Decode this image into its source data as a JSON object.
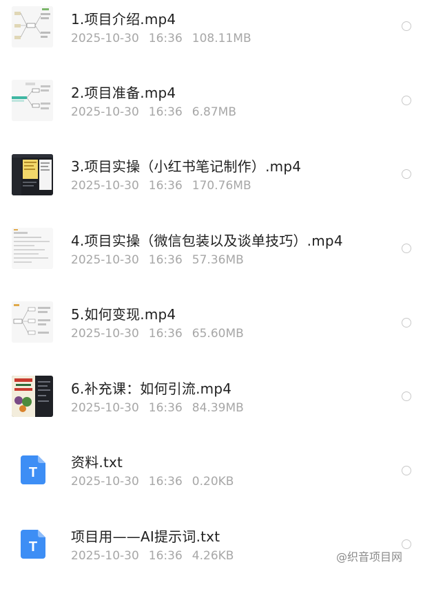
{
  "files": [
    {
      "name": "1.项目介绍.mp4",
      "date": "2025-10-30",
      "time": "16:36",
      "size": "108.11MB",
      "thumbnail": "mindmap-light"
    },
    {
      "name": "2.项目准备.mp4",
      "date": "2025-10-30",
      "time": "16:36",
      "size": "6.87MB",
      "thumbnail": "mindmap-teal"
    },
    {
      "name": "3.项目实操（小红书笔记制作）.mp4",
      "date": "2025-10-30",
      "time": "16:36",
      "size": "170.76MB",
      "thumbnail": "dark-editor"
    },
    {
      "name": "4.项目实操（微信包装以及谈单技巧）.mp4",
      "date": "2025-10-30",
      "time": "16:36",
      "size": "57.36MB",
      "thumbnail": "document-light"
    },
    {
      "name": "5.如何变现.mp4",
      "date": "2025-10-30",
      "time": "16:36",
      "size": "65.60MB",
      "thumbnail": "mindmap-light"
    },
    {
      "name": "6.补充课：如何引流.mp4",
      "date": "2025-10-30",
      "time": "16:36",
      "size": "84.39MB",
      "thumbnail": "poster-dark"
    },
    {
      "name": "资料.txt",
      "date": "2025-10-30",
      "time": "16:36",
      "size": "0.20KB",
      "thumbnail": "txt-icon"
    },
    {
      "name": "项目用——AI提示词.txt",
      "date": "2025-10-30",
      "time": "16:36",
      "size": "4.26KB",
      "thumbnail": "txt-icon"
    }
  ],
  "txt_icon_letter": "T",
  "colors": {
    "txt_icon": "#3d8ef5",
    "name_text": "#1f1f1f",
    "meta_text": "#a7a7a7",
    "radio_border": "#c8c8c8"
  },
  "watermark": "@织音项目网"
}
